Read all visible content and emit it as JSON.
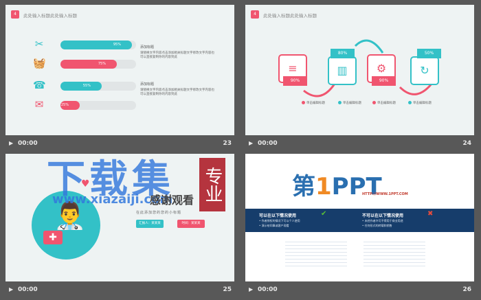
{
  "theme": {
    "teal": "#33c1c7",
    "pink": "#f0556f",
    "bg": "#585858"
  },
  "slides": [
    {
      "num": "23",
      "time": "00:00",
      "badge": "4",
      "title": "此处输入标题此处输入标题",
      "bars": [
        {
          "label": "95%",
          "value": 95,
          "color": "teal",
          "icon": "tools-icon"
        },
        {
          "label": "75%",
          "value": 75,
          "color": "pink",
          "icon": "basket-icon"
        },
        {
          "label": "55%",
          "value": 55,
          "color": "teal",
          "icon": "phone-icon"
        },
        {
          "label": "25%",
          "value": 25,
          "color": "pink",
          "icon": "mail-heart-icon"
        }
      ],
      "blocks": [
        {
          "head": "添加标题",
          "body": "请替换文字内容点击添加相关标题文字修改文字内容也可以直接复制你的内容到此"
        },
        {
          "head": "添加标题",
          "body": "请替换文字内容点击添加相关标题文字修改文字内容也可以直接复制你的内容到此"
        }
      ]
    },
    {
      "num": "24",
      "time": "00:00",
      "badge": "4",
      "title": "此处输入标题此处输入标题",
      "boxes": [
        {
          "pct": "90%",
          "color": "pink",
          "icon": "database-icon",
          "glyph": "≡"
        },
        {
          "pct": "80%",
          "color": "teal",
          "icon": "bar-chart-icon",
          "glyph": "▥"
        },
        {
          "pct": "90%",
          "color": "pink",
          "icon": "gear-icon",
          "glyph": "⚙"
        },
        {
          "pct": "50%",
          "color": "teal",
          "icon": "refresh-icon",
          "glyph": "↻"
        }
      ],
      "legend": [
        "单击编辑标题",
        "单击编辑标题",
        "单击编辑标题",
        "单击编辑标题"
      ]
    },
    {
      "num": "25",
      "time": "00:00",
      "watermark_big": "下载集",
      "watermark_url": "www.xiazaiji.com",
      "stamp": "专业",
      "thanks": "感谢观看",
      "subtitle": "在此添加您的您的小标题",
      "btn1": "汇报人：某某某",
      "btn2": "时间：某某某"
    },
    {
      "num": "26",
      "time": "00:00",
      "logo_prefix": "第",
      "logo_one": "1",
      "logo_suffix": "PPT",
      "logo_url": "HTTP://WWW.1PPT.COM",
      "can_title": "可以在以下情况使用",
      "cannot_title": "不可以在以下情况使用",
      "can_lines": [
        "• 作者授权的情况下可以个人使用",
        "• 演示给同事或客户观看"
      ],
      "cannot_lines": [
        "• 未经作者许可不得用于商业用途",
        "• 任何形式的转载和销售"
      ]
    }
  ]
}
